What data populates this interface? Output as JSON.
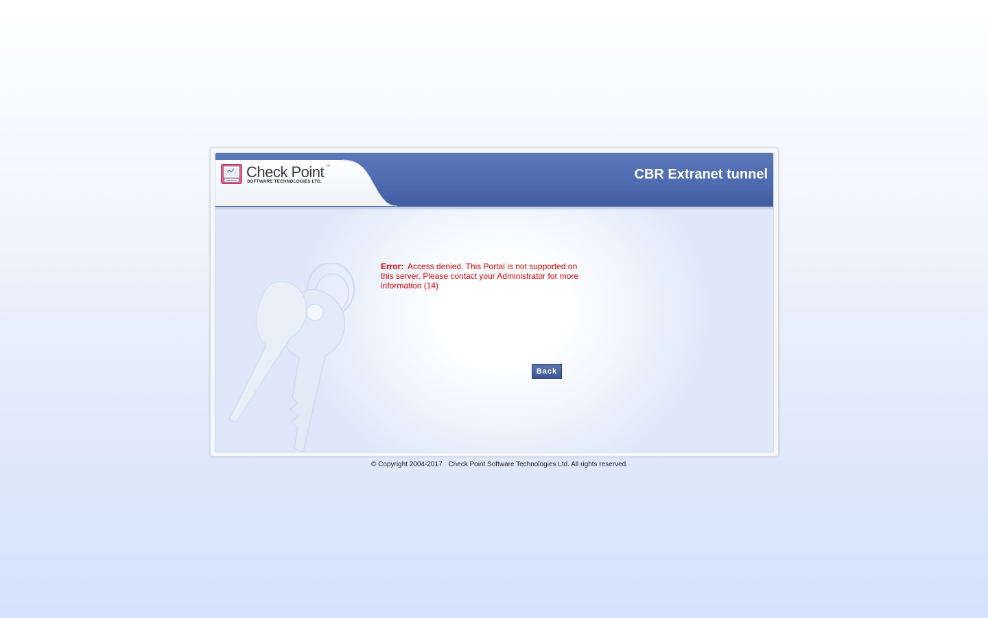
{
  "header": {
    "portal_title": "CBR Extranet tunnel"
  },
  "logo": {
    "name": "Check Point",
    "trademark": "™",
    "tagline": "SOFTWARE TECHNOLOGIES LTD."
  },
  "error": {
    "label": "Error:",
    "message": "Access denied. This Portal is not supported on this server. Please contact your Administrator for more information (14)"
  },
  "actions": {
    "back_label": "Back"
  },
  "footer": {
    "copyright": "© Copyright 2004-2017",
    "company": "Check Point Software Technologies Ltd. All rights reserved."
  },
  "colors": {
    "header_blue": "#4a67ad",
    "error_red": "#cc0000",
    "button_blue": "#4a62a0"
  },
  "icons": [
    "check-point-logo-icon",
    "key-watermark-icon"
  ]
}
